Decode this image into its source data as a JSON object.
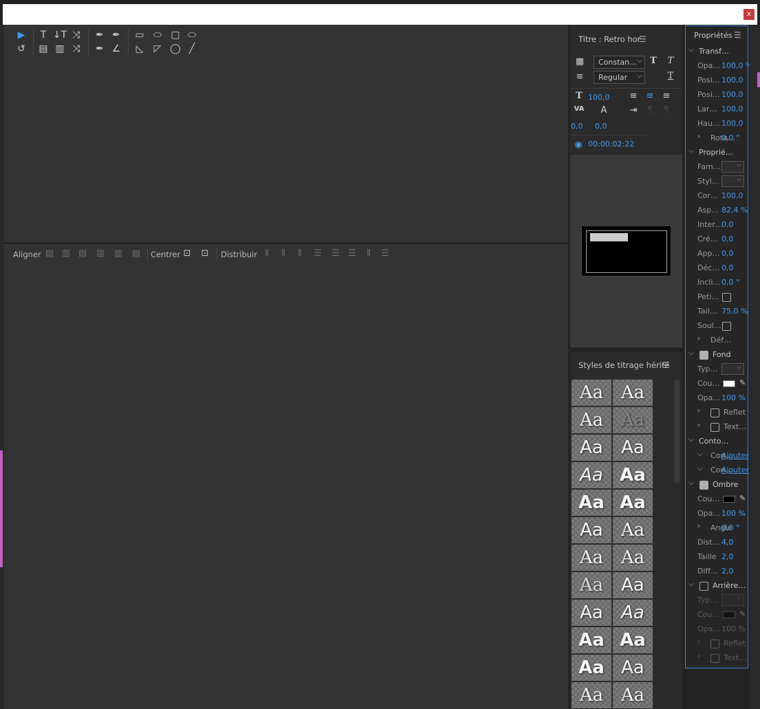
{
  "window": {
    "close_label": "x"
  },
  "tools_row1": [
    "▶",
    "T",
    "↓T",
    "⤨",
    "✒",
    "✒",
    "▭",
    "⬭",
    "▢",
    "⬭"
  ],
  "tools_row2": [
    "↺",
    "▤",
    "▥",
    "⤨",
    "✒",
    "∠",
    "◺",
    "◸",
    "◯",
    "╱"
  ],
  "align": {
    "align_label": "Aligner",
    "center_label": "Centrer",
    "distribute_label": "Distribuir"
  },
  "title_panel": {
    "title": "Titre : Retro hor",
    "font_family": "Constan…",
    "font_style": "Regular",
    "size": "100,0",
    "kerning": "0,0",
    "leading": "0,0",
    "timecode": "00:00:02:22"
  },
  "styles_panel": {
    "title": "Styles de titrage hérité",
    "samples": [
      "Aa",
      "Aa",
      "Aa",
      "Aa",
      "Aa",
      "Aa",
      "Aa",
      "Aa",
      "Aa",
      "Aa",
      "Aa",
      "Aa",
      "Aa",
      "Aa",
      "Aa",
      "Aa",
      "Aa",
      "Aa",
      "Aa",
      "Aa",
      "Aa",
      "Aa",
      "Aa",
      "Aa"
    ]
  },
  "props": {
    "title": "Propriétés",
    "transform": {
      "label": "Transf…",
      "opacity": {
        "l": "Opa…",
        "v": "100,0 %"
      },
      "posx": {
        "l": "Posi…",
        "v": "100,0"
      },
      "posy": {
        "l": "Posi…",
        "v": "100,0"
      },
      "width": {
        "l": "Lar…",
        "v": "100,0"
      },
      "height": {
        "l": "Hau…",
        "v": "100,0"
      },
      "rotation": {
        "l": "Rota…",
        "v": "0,0 °"
      }
    },
    "properties": {
      "label": "Proprié…",
      "family": "Fam…",
      "style": "Styl…",
      "size": {
        "l": "Cor…",
        "v": "100,0"
      },
      "aspect": {
        "l": "Asp…",
        "v": "82,4 %"
      },
      "leading": {
        "l": "Inter…",
        "v": "0,0"
      },
      "kerning": {
        "l": "Cré…",
        "v": "0,0"
      },
      "tracking": {
        "l": "App…",
        "v": "0,0"
      },
      "baseline": {
        "l": "Déc…",
        "v": "0,0"
      },
      "slant": {
        "l": "Incli…",
        "v": "0,0 °"
      },
      "smallcaps": "Peti…",
      "smallcaps_size": {
        "l": "Tail…",
        "v": "75,0 %"
      },
      "underline": "Soul…",
      "distort": "Déf…"
    },
    "fill": {
      "label": "Fond",
      "type": "Typ…",
      "color": "Cou…",
      "opacity": {
        "l": "Opa…",
        "v": "100 %"
      },
      "sheen": "Reflet",
      "texture": "Text…"
    },
    "strokes": {
      "label": "Conto…",
      "inner": "Con…",
      "outer": "Con…",
      "add": "Ajouter"
    },
    "shadow": {
      "label": "Ombre",
      "color": "Cou…",
      "opacity": {
        "l": "Opa…",
        "v": "100 %"
      },
      "angle": {
        "l": "Angle",
        "v": "0,0 °"
      },
      "distance": {
        "l": "Dist…",
        "v": "4,0"
      },
      "size": {
        "l": "Taille",
        "v": "2,0"
      },
      "spread": {
        "l": "Diff…",
        "v": "2,0"
      }
    },
    "background": {
      "label": "Arrière…",
      "type": "Typ…",
      "color": "Cou…",
      "opacity": {
        "l": "Opa…",
        "v": "100 %"
      },
      "sheen": "Reflet",
      "texture": "Text…"
    }
  }
}
